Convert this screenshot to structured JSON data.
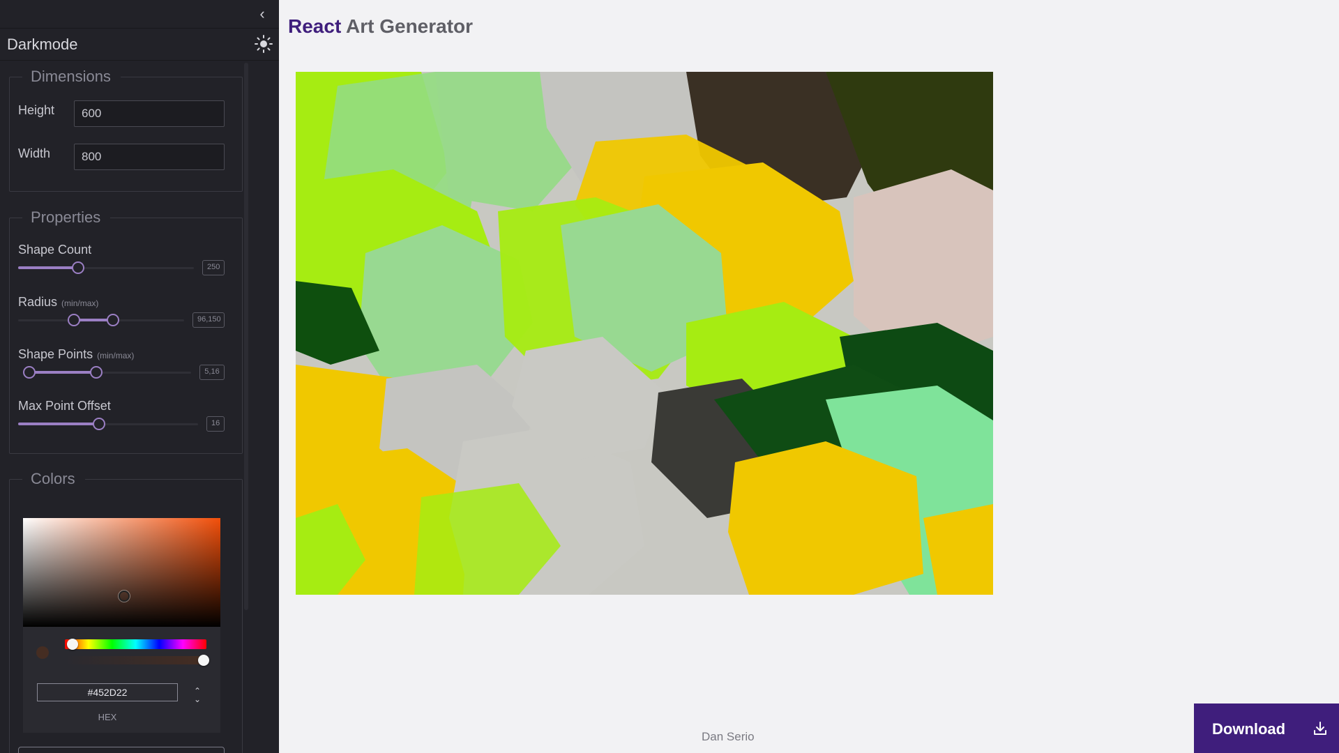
{
  "sidebar": {
    "mode_label": "Darkmode",
    "dimensions": {
      "legend": "Dimensions",
      "height_label": "Height",
      "height_value": "600",
      "width_label": "Width",
      "width_value": "800"
    },
    "properties": {
      "legend": "Properties",
      "shape_count": {
        "label": "Shape Count",
        "value": "250"
      },
      "radius": {
        "label": "Radius",
        "sub": "(min/max)",
        "value": "96,150"
      },
      "shape_points": {
        "label": "Shape Points",
        "sub": "(min/max)",
        "value": "5,16"
      },
      "max_point_offset": {
        "label": "Max Point Offset",
        "value": "16"
      }
    },
    "colors": {
      "legend": "Colors",
      "hex_value": "#452D22",
      "hex_label": "HEX",
      "selected_color": "#452D22"
    }
  },
  "header": {
    "title_brand": "React",
    "title_rest": " Art Generator"
  },
  "footer": {
    "author": "Dan Serio"
  },
  "download": {
    "label": "Download"
  },
  "colors": {
    "accent": "#3f1e7c",
    "slider": "#9b7fc4",
    "sidebar_bg": "#222228",
    "page_bg": "#f2f2f4"
  }
}
